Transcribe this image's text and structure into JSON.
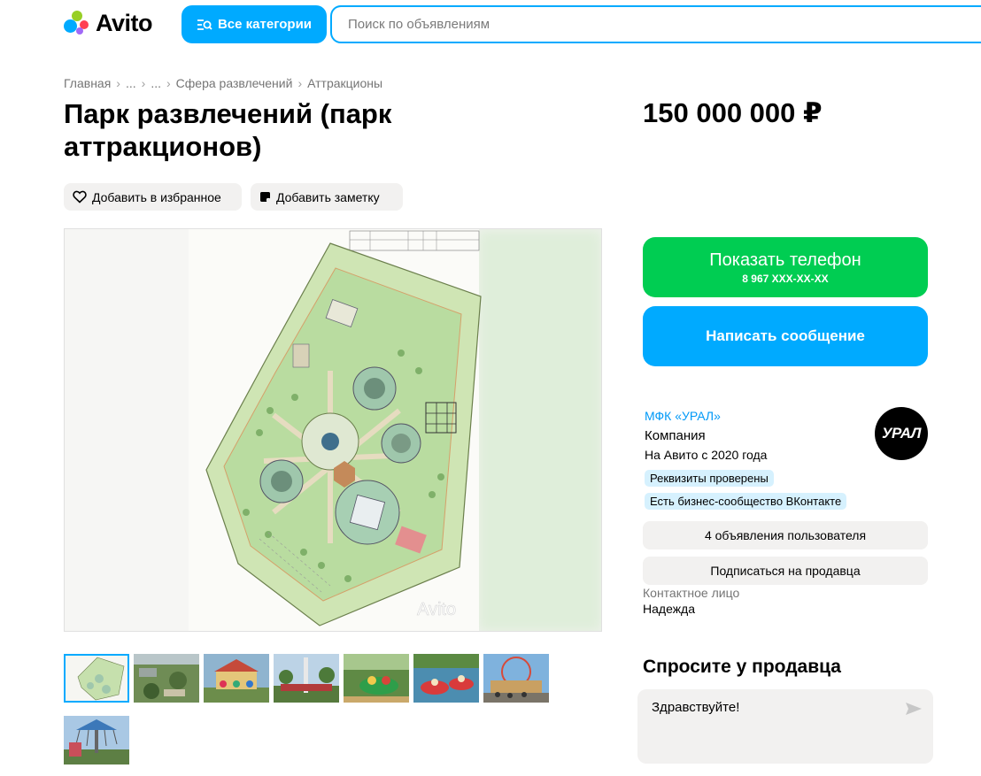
{
  "header": {
    "logo_text": "Avito",
    "categories_label": "Все категории",
    "search_placeholder": "Поиск по объявлениям",
    "brand_color": "#00aaff"
  },
  "breadcrumb": [
    "Главная",
    "...",
    "...",
    "Сфера развлечений",
    "Аттракционы"
  ],
  "listing": {
    "title": "Парк развлечений (парк аттракционов)",
    "price": "150 000 000 ₽",
    "favorite_label": "Добавить в избранное",
    "note_label": "Добавить заметку",
    "watermark": "Avito"
  },
  "actions": {
    "phone_label": "Показать телефон",
    "phone_number": "8 967 XXX-XX-XX",
    "message_label": "Написать сообщение",
    "phone_color": "#00cd52"
  },
  "seller": {
    "name": "МФК «УРАЛ»",
    "type": "Компания",
    "since": "На Авито с 2020 года",
    "avatar_text": "УРАЛ",
    "badges": [
      "Реквизиты проверены",
      "Есть бизнес-сообщество ВКонтакте"
    ],
    "listings_label": "4 объявления пользователя",
    "subscribe_label": "Подписаться на продавца",
    "contact_label": "Контактное лицо",
    "contact_name": "Надежда"
  },
  "ask": {
    "title": "Спросите у продавца",
    "message": "Здравствуйте!"
  },
  "thumbnails": [
    "site-plan",
    "aerial-view",
    "carousel",
    "drop-tower",
    "kiddie-ride",
    "bumper-boats",
    "ferris-wheel",
    "swing-ride"
  ]
}
